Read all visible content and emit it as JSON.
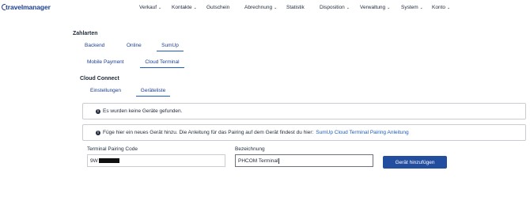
{
  "header": {
    "logo_text": "travelmanager",
    "nav": [
      {
        "label": "Verkauf",
        "dropdown": true
      },
      {
        "label": "Kontakte",
        "dropdown": true
      },
      {
        "label": "Gutschein",
        "dropdown": false
      },
      {
        "label": "Abrechnung",
        "dropdown": true
      },
      {
        "label": "Statistik",
        "dropdown": false
      },
      {
        "label": "Disposition",
        "dropdown": true
      },
      {
        "label": "Verwaltung",
        "dropdown": true
      },
      {
        "label": "System",
        "dropdown": true
      },
      {
        "label": "Konto",
        "dropdown": true
      }
    ]
  },
  "payments": {
    "title": "Zahlarten",
    "tabs": [
      "Backend",
      "Online",
      "SumUp"
    ],
    "active_tab": "SumUp",
    "subtabs": [
      "Mobile Payment",
      "Cloud Terminal"
    ],
    "active_subtab": "Cloud Terminal"
  },
  "cloud_connect": {
    "title": "Cloud Connect",
    "tabs": [
      "Einstellungen",
      "Geräteliste"
    ],
    "active_tab": "Geräteliste"
  },
  "alerts": {
    "no_devices": "Es wurden keine Geräte gefunden.",
    "add_info": "Füge hier ein neues Gerät hinzu. Die Anleitung für das Pairing auf dem Gerät findest du hier:",
    "add_info_link": "SumUp Cloud Terminal Pairing Anleitung"
  },
  "form": {
    "pairing_code_label": "Terminal Pairing Code",
    "pairing_code_value": "9W",
    "name_label": "Bezeichnung",
    "name_value": "PHCOM Terminal",
    "submit_label": "Gerät hinzufügen"
  },
  "colors": {
    "brand": "#1d3f8f",
    "accent": "#1d5bbf",
    "button": "#234d9e"
  }
}
